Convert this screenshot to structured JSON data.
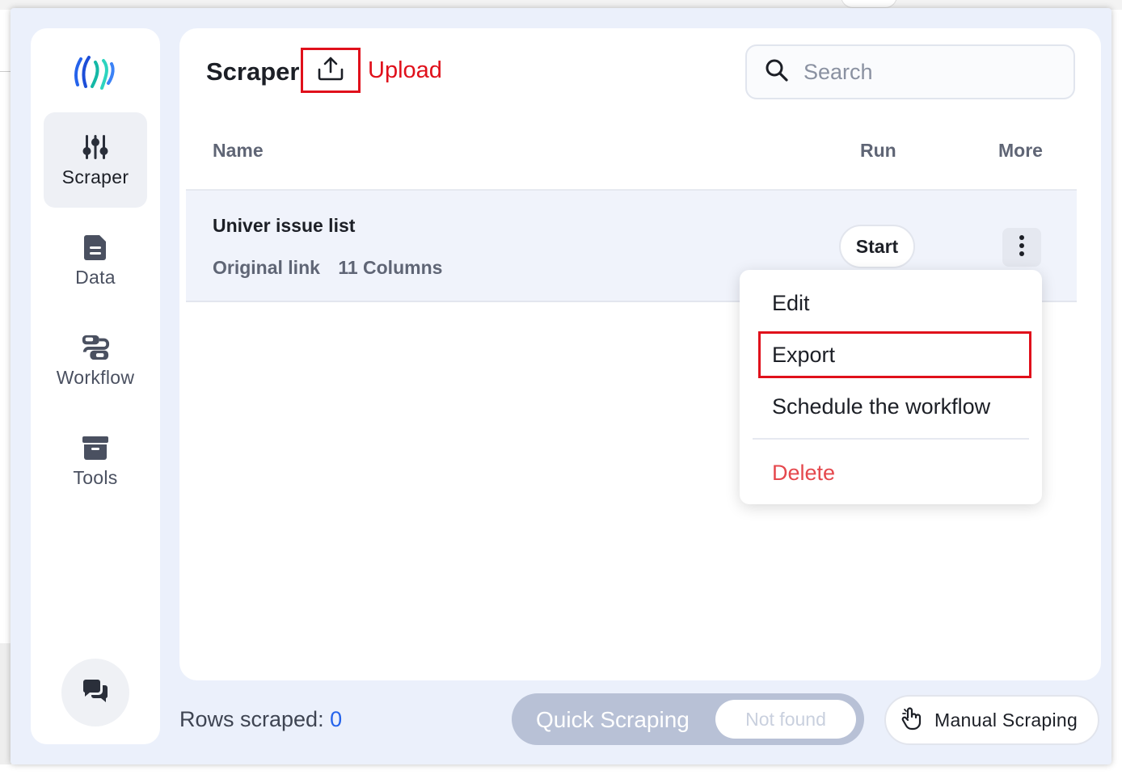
{
  "app": {
    "title": "Scraper",
    "upload_label": "Upload"
  },
  "search": {
    "placeholder": "Search"
  },
  "sidebar": {
    "items": [
      {
        "label": "Scraper",
        "icon": "sliders-icon",
        "active": true
      },
      {
        "label": "Data",
        "icon": "document-icon",
        "active": false
      },
      {
        "label": "Workflow",
        "icon": "workflow-icon",
        "active": false
      },
      {
        "label": "Tools",
        "icon": "archive-box-icon",
        "active": false
      }
    ],
    "chat_icon": "chat-bubbles-icon"
  },
  "table": {
    "headers": {
      "name": "Name",
      "run": "Run",
      "more": "More"
    },
    "rows": [
      {
        "name": "Univer issue list",
        "link": "Original link",
        "columns": "11 Columns",
        "run_label": "Start"
      }
    ]
  },
  "menu": {
    "edit": "Edit",
    "export": "Export",
    "schedule": "Schedule the workflow",
    "delete": "Delete"
  },
  "footer": {
    "rows_scraped_label": "Rows scraped:",
    "rows_scraped_count": "0",
    "quick_scraping": "Quick Scraping",
    "not_found": "Not found",
    "manual_scraping": "Manual Scraping"
  },
  "colors": {
    "accent_red": "#e0101b",
    "danger": "#e5484d",
    "count_blue": "#2563eb",
    "popup_bg": "#ebf0fb"
  }
}
